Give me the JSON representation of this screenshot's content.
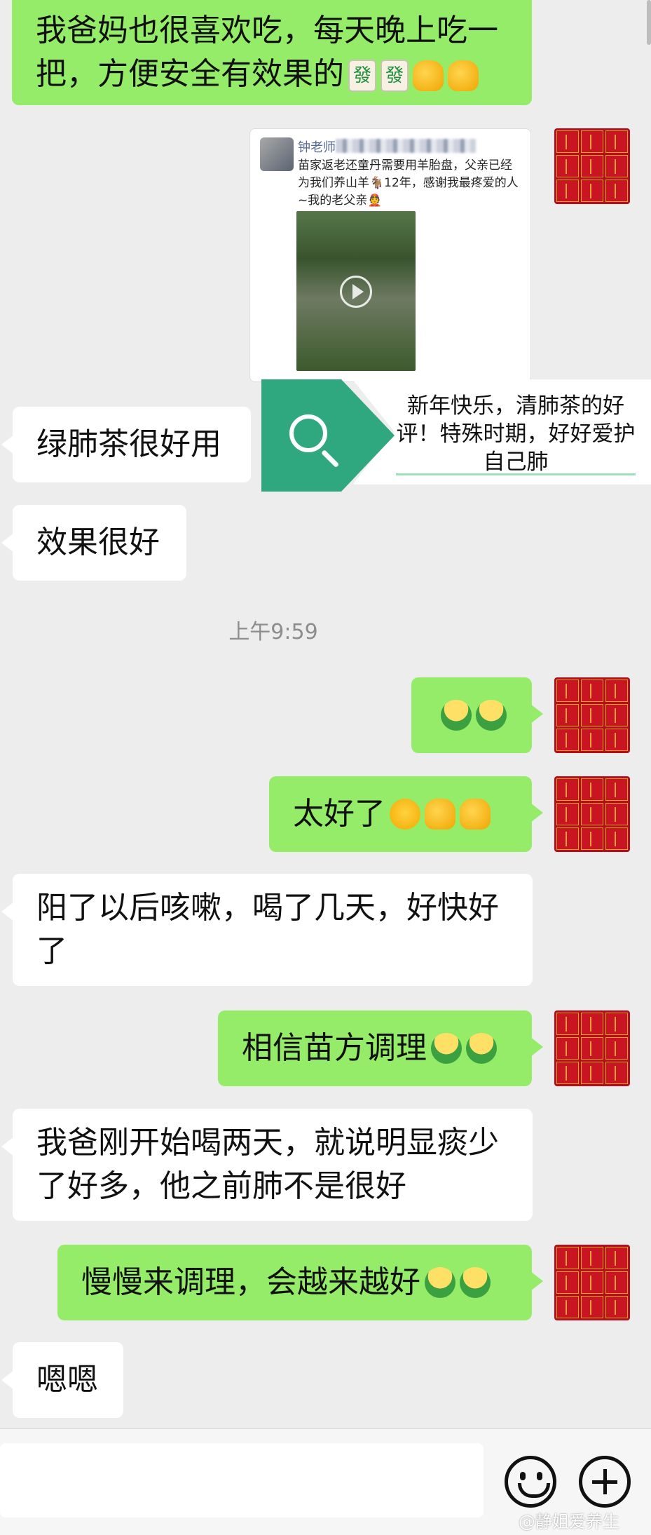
{
  "chat": {
    "msg_top": {
      "line1": "我爸妈也很喜欢吃，每天晚上吃一",
      "line2": "把，方便安全有效果的"
    },
    "shared_card": {
      "author": "钟老师",
      "text": "苗家返老还童丹需要用羊胎盘，父亲已经为我们养山羊🐐12年，感谢我最疼爱的人~我的老父亲👲"
    },
    "msg_lvfei": "绿肺茶很好用",
    "search_ad_text": "新年快乐，清肺茶的好评！特殊时期，好好爱护自己肺",
    "msg_xiaoguo": "效果很好",
    "timestamp": "上午9:59",
    "msg_taihao": "太好了",
    "msg_yang": {
      "line1": "阳了以后咳嗽，喝了几天，好快好",
      "line2": "了"
    },
    "msg_xiangxin": "相信苗方调理",
    "msg_baba": {
      "line1": "我爸刚开始喝两天，就说明显痰少",
      "line2": "了好多，他之前肺不是很好"
    },
    "msg_manman": "慢慢来调理，会越来越好",
    "msg_enen": "嗯嗯"
  },
  "emoji_glyph_fa": "發",
  "watermark": "@静姐爱养生",
  "colors": {
    "background": "#ededed",
    "green_bubble": "#95ec69",
    "white_bubble": "#ffffff",
    "search_green": "#2fa880",
    "timestamp": "#8d8d8d"
  }
}
